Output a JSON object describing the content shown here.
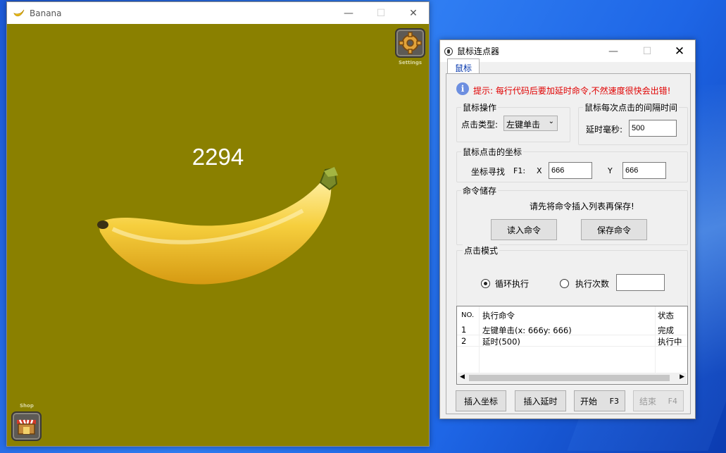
{
  "banana_window": {
    "title": "Banana",
    "counter": "2294",
    "settings_label": "Settings",
    "shop_label": "Shop",
    "bg_color": "#8a8000"
  },
  "clicker": {
    "title": "鼠标连点器",
    "tab": "鼠标",
    "tip": "提示: 每行代码后要加延时命令,不然速度很快会出错!",
    "mouse_op": {
      "group": "鼠标操作",
      "type_label": "点击类型:",
      "type_value": "左键单击"
    },
    "interval": {
      "group": "鼠标每次点击的间隔时间",
      "label": "延时毫秒:",
      "value": "500"
    },
    "coords": {
      "group": "鼠标点击的坐标",
      "find_label": "坐标寻找",
      "hotkey": "F1:",
      "x_label": "X",
      "x_value": "666",
      "y_label": "Y",
      "y_value": "666"
    },
    "storage": {
      "group": "命令储存",
      "hint": "请先将命令插入列表再保存!",
      "read_btn": "读入命令",
      "save_btn": "保存命令"
    },
    "mode": {
      "group": "点击模式",
      "loop": "循环执行",
      "count": "执行次数",
      "count_value": ""
    },
    "table": {
      "headers": [
        "NO.",
        "执行命令",
        "状态"
      ],
      "rows": [
        [
          "1",
          "左键单击(x: 666y: 666)",
          "完成"
        ],
        [
          "2",
          "延时(500)",
          "执行中"
        ]
      ]
    },
    "buttons": {
      "insert_coord": "插入坐标",
      "insert_delay": "插入延时",
      "start": "开始",
      "start_key": "F3",
      "stop": "结束",
      "stop_key": "F4"
    }
  }
}
